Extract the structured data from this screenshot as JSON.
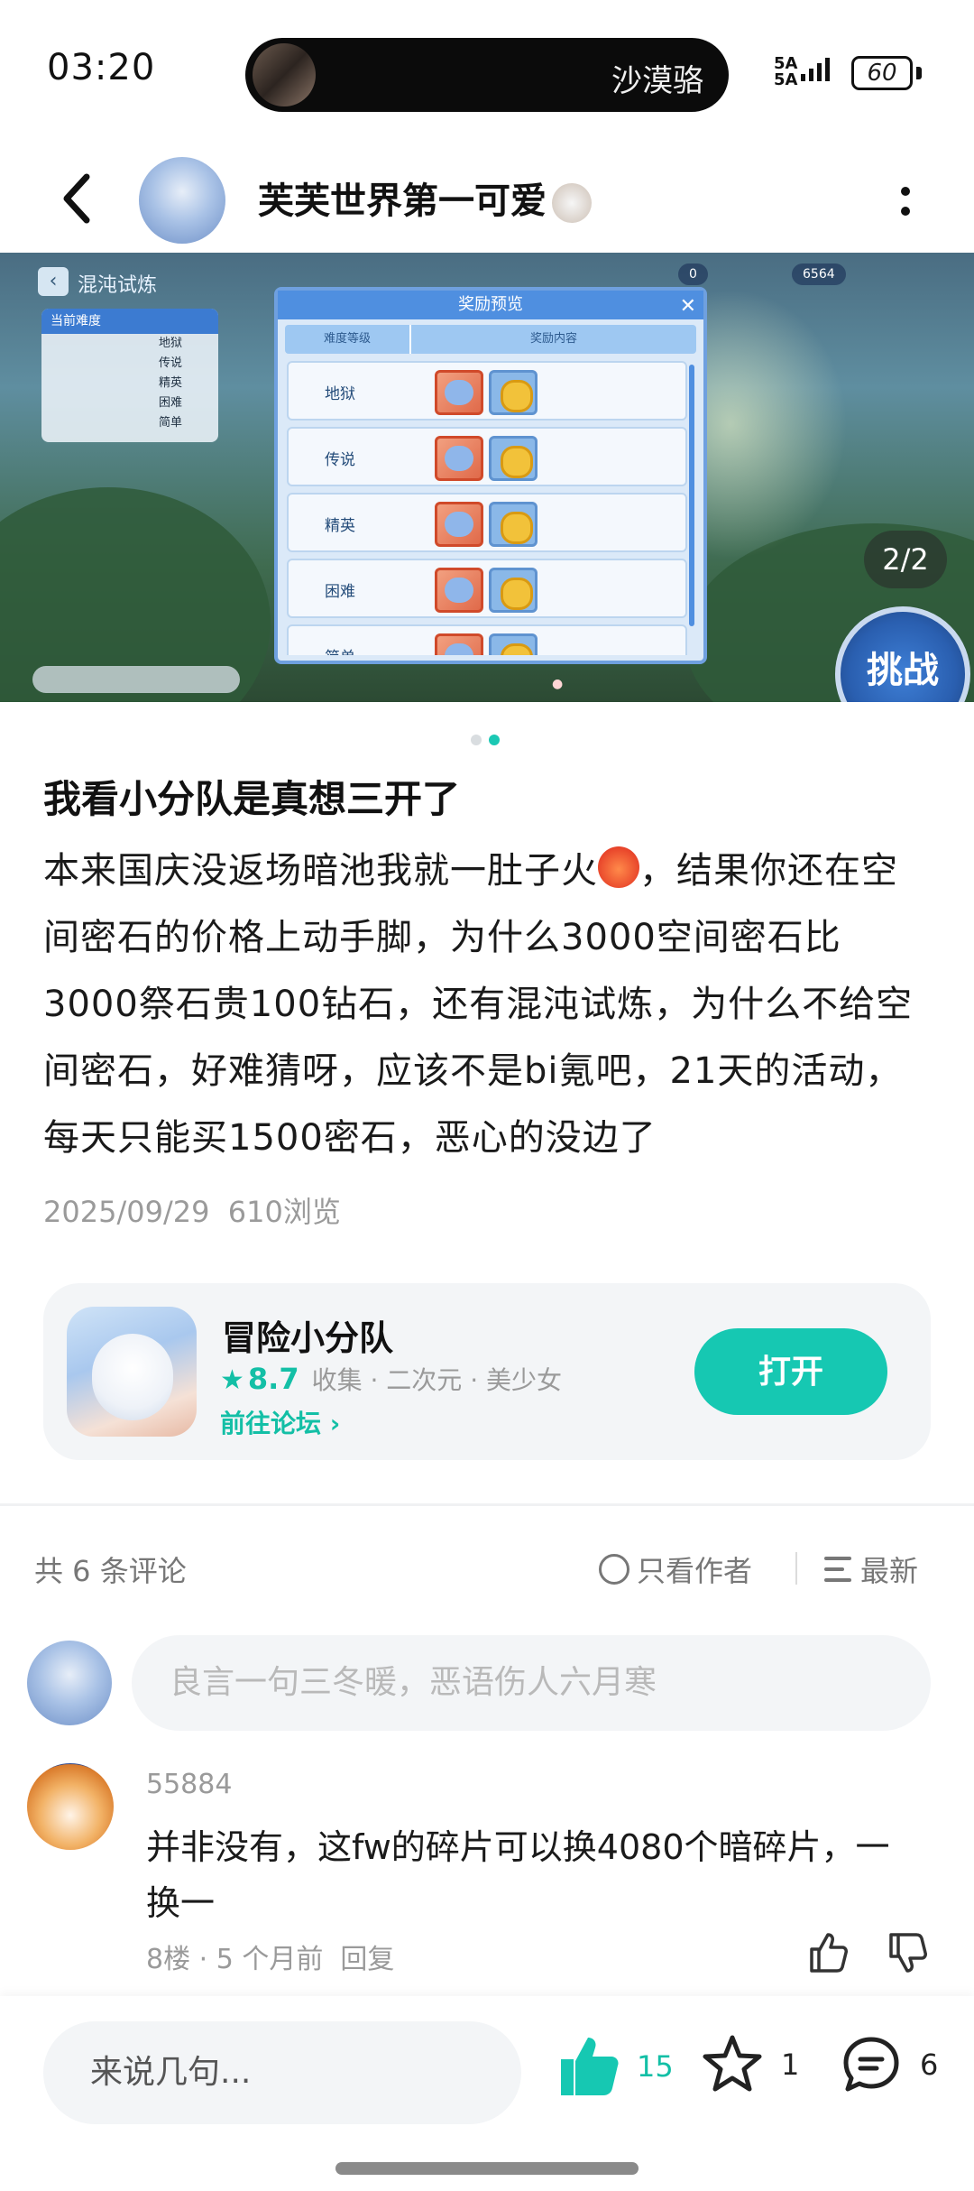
{
  "status_bar": {
    "time": "03:20",
    "island_text": "沙漠骆",
    "network_label": "5A\n5A",
    "battery": "60"
  },
  "header": {
    "title": "芙芙世界第一可爱"
  },
  "carousel": {
    "counter": "2/2",
    "game_screen": {
      "mode_label": "混沌试炼",
      "dialog_title": "奖励预览",
      "col_difficulty": "难度等级",
      "col_rewards": "奖励内容",
      "rows": [
        "地狱",
        "传说",
        "精英",
        "困难",
        "简单"
      ],
      "panel_items": [
        "地狱",
        "传说",
        "精英",
        "困难",
        "简单"
      ],
      "panel_head": "当前难度",
      "resource_a": "0",
      "resource_b": "6564",
      "challenge_label": "挑战"
    }
  },
  "post": {
    "title": "我看小分队是真想三开了",
    "body_1": "本来国庆没返场暗池我就一肚子火",
    "body_2": "，结果你还在空间密石的价格上动手脚，为什么3000空间密石比3000祭石贵100钻石，还有混沌试炼，为什么不给空间密石，好难猜呀，应该不是bi氪吧，21天的活动，每天只能买1500密石，恶心的没边了",
    "date": "2025/09/29",
    "views": "610浏览"
  },
  "app_card": {
    "name": "冒险小分队",
    "score": "8.7",
    "tags": "收集 · 二次元 · 美少女",
    "forum_link": "前往论坛 ›",
    "open_label": "打开"
  },
  "comments": {
    "count_label": "共 6 条评论",
    "author_only": "只看作者",
    "sort_label": "最新",
    "input_placeholder": "良言一句三冬暖，恶语伤人六月寒",
    "items": [
      {
        "user": "55884",
        "text": "并非没有，这fw的碎片可以换4080个暗碎片，一换一",
        "meta": "8楼 · 5 个月前",
        "reply": "回复"
      }
    ]
  },
  "bottom_bar": {
    "reply_placeholder": "来说几句...",
    "likes": "15",
    "favorites": "1",
    "comments": "6"
  },
  "colors": {
    "accent": "#16c8b2",
    "text": "#1a1a1a",
    "muted": "#9a9a9a",
    "card_bg": "#f3f5f7"
  }
}
